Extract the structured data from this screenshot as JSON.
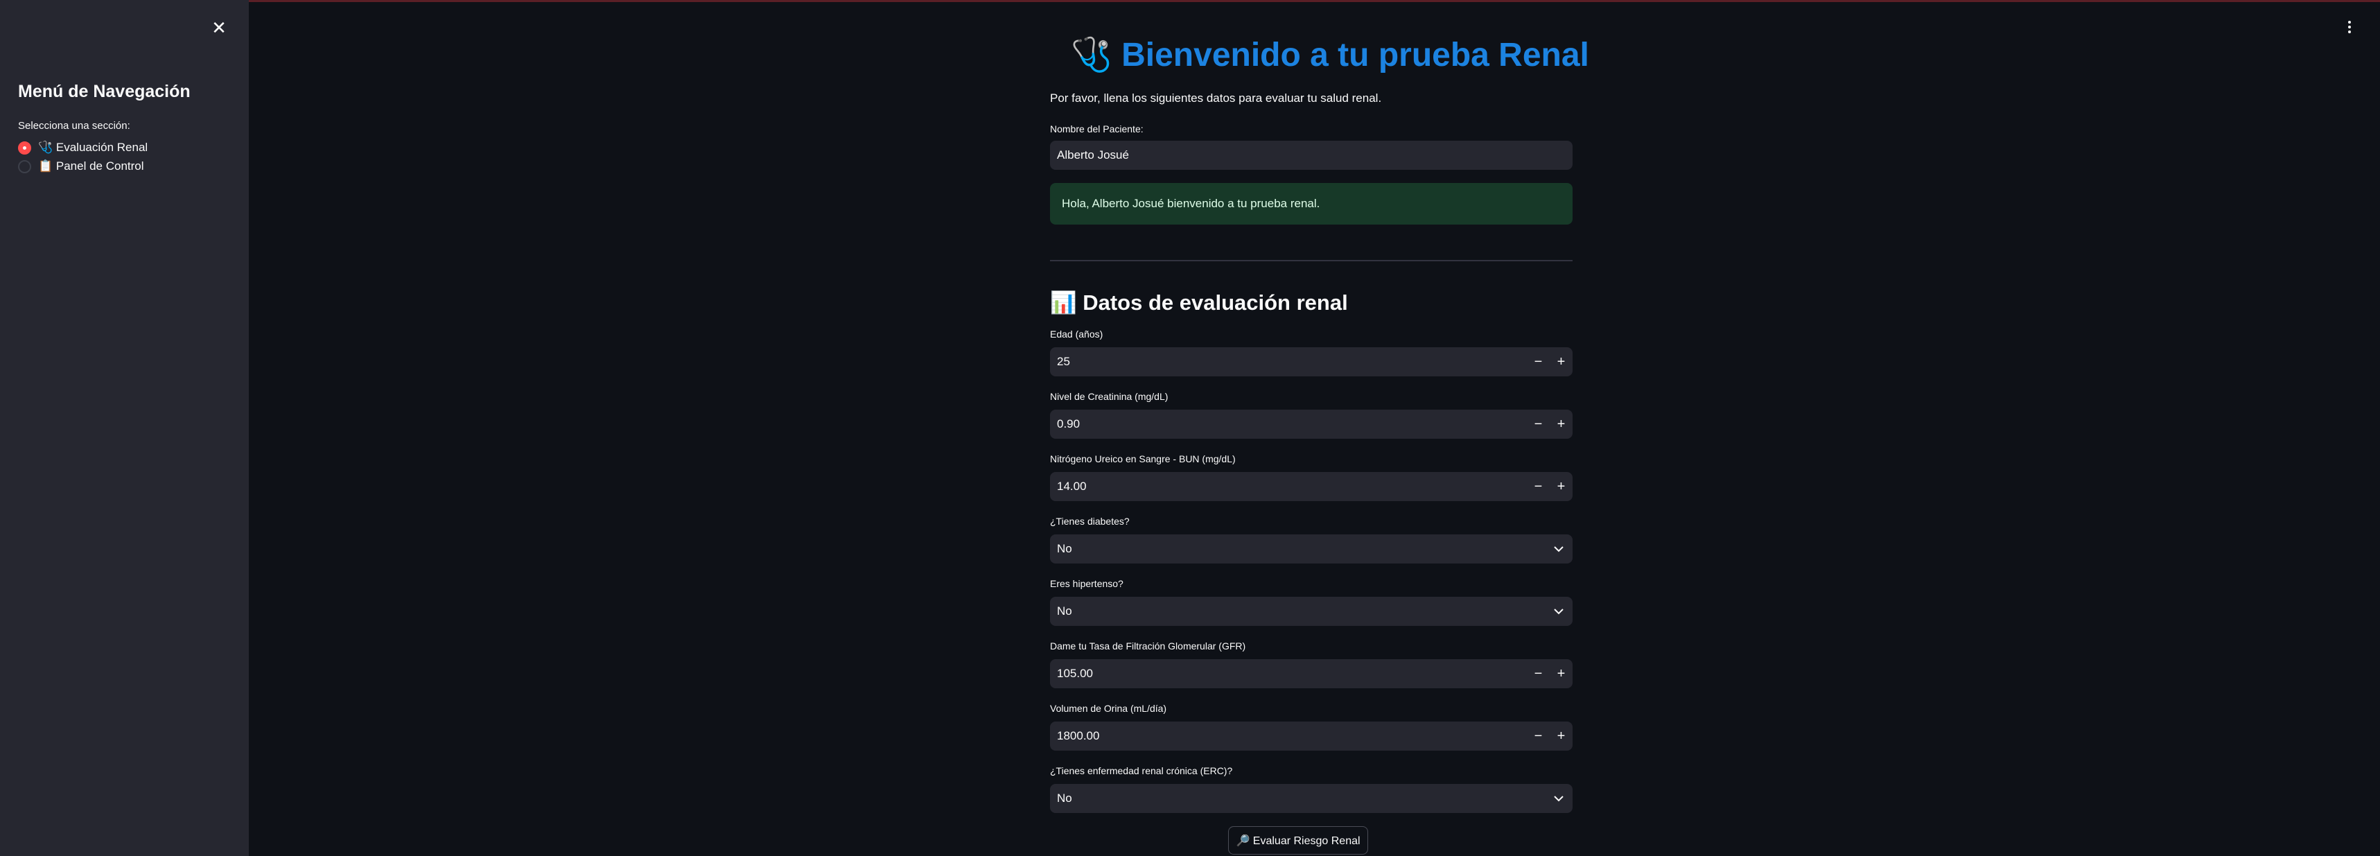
{
  "sidebar": {
    "close_icon": "close-icon",
    "title": "Menú de Navegación",
    "caption": "Selecciona una sección:",
    "options": [
      {
        "label": "🩺 Evaluación Renal",
        "selected": true
      },
      {
        "label": "📋 Panel de Control",
        "selected": false
      }
    ]
  },
  "header": {
    "menu_icon": "kebab-menu-icon"
  },
  "main": {
    "title": "🩺 Bienvenido a tu prueba Renal",
    "title_color": "#1c83e1",
    "subtitle": "Por favor, llena los siguientes datos para evaluar tu salud renal.",
    "patient_label": "Nombre del Paciente:",
    "patient_value": "Alberto Josué",
    "greeting": "Hola, Alberto Josué bienvenido a tu prueba renal.",
    "section_title": "📊 Datos de evaluación renal",
    "fields": {
      "edad": {
        "label": "Edad (años)",
        "value": "25"
      },
      "creatinina": {
        "label": "Nivel de Creatinina (mg/dL)",
        "value": "0.90"
      },
      "bun": {
        "label": "Nitrógeno Ureico en Sangre - BUN (mg/dL)",
        "value": "14.00"
      },
      "diabetes": {
        "label": "¿Tienes diabetes?",
        "value": "No"
      },
      "hipertenso": {
        "label": "Eres hipertenso?",
        "value": "No"
      },
      "gfr": {
        "label": "Dame tu Tasa de Filtración Glomerular (GFR)",
        "value": "105.00"
      },
      "orina": {
        "label": "Volumen de Orina (mL/día)",
        "value": "1800.00"
      },
      "erc": {
        "label": "¿Tienes enfermedad renal crónica (ERC)?",
        "value": "No"
      }
    },
    "stepper_minus": "−",
    "stepper_plus": "+",
    "button_label": "🔎 Evaluar Riesgo Renal"
  },
  "colors": {
    "background": "#0e1117",
    "sidebar": "#262730",
    "input": "#262730",
    "accent": "#ff4b4b",
    "success_bg": "#173928",
    "title": "#1c83e1"
  }
}
